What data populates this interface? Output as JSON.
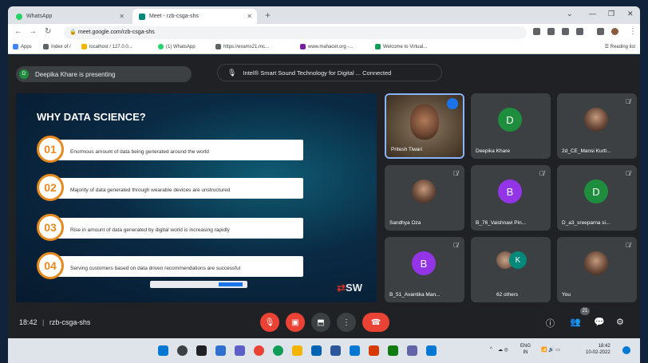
{
  "browser": {
    "tabs": [
      {
        "title": "WhatsApp",
        "active": false
      },
      {
        "title": "Meet - rzb-csga-shs",
        "active": true
      }
    ],
    "url": "meet.google.com/rzb-csga-shs",
    "bookmarks": [
      "Apps",
      "Index of /",
      "localhost / 127.0.0...",
      "(1) WhatsApp",
      "https://exams21.mc...",
      "www.mahacet.org -...",
      "Welcome to Virtual..."
    ],
    "reading_list": "Reading list"
  },
  "meet": {
    "presenter_initial": "D",
    "presenter_text": "Deepika Khare is presenting",
    "notification": "Intel® Smart Sound Technology for Digital ... Connected",
    "time": "18:42",
    "meeting_code": "rzb-csga-shs",
    "participant_badge": "21"
  },
  "slide": {
    "title": "WHY DATA SCIENCE?",
    "items": [
      {
        "num": "01",
        "text": "Enormous amount of data being generated around the world"
      },
      {
        "num": "02",
        "text": "Majority of data generated through wearable devices are unstructured"
      },
      {
        "num": "03",
        "text": "Rise in amount of data generated by digital world is increasing rapidly"
      },
      {
        "num": "04",
        "text": "Serving customers based on data driven recommendations are successful"
      }
    ],
    "logo_left": "⇄",
    "logo_mid": "SW",
    "accent": "#e48a1f"
  },
  "tiles": [
    {
      "name": "Pritesh Tiwari",
      "kind": "video"
    },
    {
      "name": "Deepika Khare",
      "initial": "D",
      "color": "#1e8e3e"
    },
    {
      "name": "2d_CE_Mansi Kurtl...",
      "kind": "photo"
    },
    {
      "name": "Sandhya Oza",
      "kind": "photo"
    },
    {
      "name": "B_76_Vaishnavi Pin...",
      "initial": "B",
      "color": "#9334e6"
    },
    {
      "name": "D_a3_sreeparna si...",
      "initial": "D",
      "color": "#1e8e3e"
    },
    {
      "name": "B_51_Avantika Man...",
      "initial": "B",
      "color": "#9334e6"
    },
    {
      "name": "62 others",
      "kind": "others",
      "initial": "K"
    },
    {
      "name": "You",
      "kind": "photo"
    }
  ],
  "taskbar": {
    "lang": "ENG",
    "region": "IN",
    "clock_time": "18:42",
    "clock_date": "10-02-2022"
  },
  "icons": {
    "mic_off": "mic-off-icon",
    "cam_off": "camera-off-icon",
    "present": "present-icon",
    "more": "more-icon",
    "leave": "leave-call-icon"
  }
}
